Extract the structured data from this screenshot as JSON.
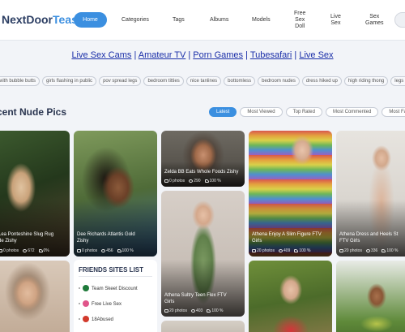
{
  "header": {
    "logo_main": "NextDoor",
    "logo_accent": "Tease",
    "nav": {
      "home": "Home",
      "categories": "Categories",
      "tags": "Tags",
      "albums": "Albums",
      "models": "Models",
      "free_sex_doll_1": "Free",
      "free_sex_doll_2": "Sex",
      "free_sex_doll_3": "Doll",
      "live_sex_1": "Live",
      "live_sex_2": "Sex",
      "sex_games_1": "Sex",
      "sex_games_2": "Games"
    }
  },
  "live_links": [
    "Live Sex Cams",
    "Amateur TV",
    "Porn Games",
    "Tubesafari",
    "Live Sex"
  ],
  "tags": [
    "with bubble butts",
    "girls flashing in public",
    "pov spread legs",
    "bedroom titties",
    "nice tanlines",
    "bottomless",
    "bedroom nudes",
    "dress hiked up",
    "high riding thong",
    "legs up"
  ],
  "section_title": "cent Nude Pics",
  "sort_tabs": [
    "Latest",
    "Most Viewed",
    "Top Rated",
    "Most Commented",
    "Most Favori"
  ],
  "cards": [
    {
      "caption_1": "Lea Ponteshine Slug Rug",
      "caption_2": "de Zishy",
      "photos": "0 photos",
      "views": "672",
      "rating": "0%"
    },
    {
      "caption_1": "Dee Richards Atlantis Gold",
      "caption_2": "Zishy",
      "photos": "0 photos",
      "views": "456",
      "rating": "100 %"
    },
    {
      "caption_1": "Zelda BB Eats Whole Foods Zishy",
      "caption_2": "",
      "photos": "0 photos",
      "views": "290",
      "rating": "100 %"
    },
    {
      "caption_1": "Athena Sultry Teen Flex FTV",
      "caption_2": "Girls",
      "photos": "20 photos",
      "views": "403",
      "rating": "100 %"
    },
    {
      "caption_1": "Athena Enjoy A Slim Figure FTV",
      "caption_2": "Girls",
      "photos": "20 photos",
      "views": "409",
      "rating": "100 %"
    },
    {
      "caption_1": "Athena Dress and Heels St",
      "caption_2": "FTV Girls",
      "photos": "20 photos",
      "views": "336",
      "rating": "100 %"
    }
  ],
  "friends": {
    "title": "FRIENDS SITES LIST",
    "items": [
      "Team Skeet Discount",
      "Free Live Sex",
      "18Abused"
    ]
  },
  "colors": {
    "accent": "#3b8fe0",
    "link": "#1a2ea8",
    "heading": "#2a3550"
  },
  "icons": [
    "photos-icon",
    "eye-icon",
    "thumb-up-icon",
    "theme-toggle-icon"
  ]
}
